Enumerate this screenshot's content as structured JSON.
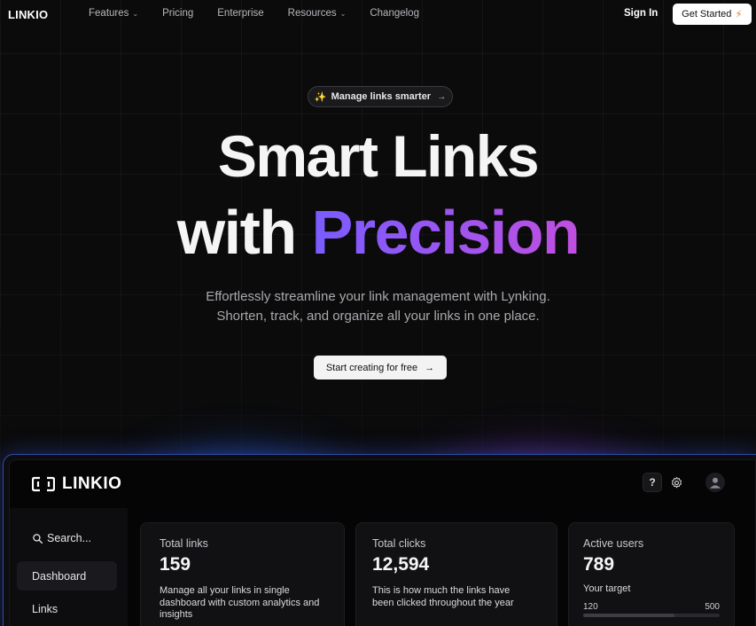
{
  "nav": {
    "logo": "LINKIO",
    "links": [
      {
        "label": "Features",
        "dropdown": true
      },
      {
        "label": "Pricing",
        "dropdown": false
      },
      {
        "label": "Enterprise",
        "dropdown": false
      },
      {
        "label": "Resources",
        "dropdown": true
      },
      {
        "label": "Changelog",
        "dropdown": false
      }
    ],
    "sign_in": "Sign In",
    "get_started": "Get Started"
  },
  "hero": {
    "badge": "Manage links smarter",
    "title_line1": "Smart Links",
    "title_line2_plain": "with ",
    "title_line2_accent": "Precision",
    "subtitle_line1": "Effortlessly streamline your link management with Lynking.",
    "subtitle_line2": "Shorten, track, and organize all your links in one place.",
    "cta": "Start creating for free"
  },
  "dashboard": {
    "logo": "LINKIO",
    "help_label": "?",
    "sidebar": {
      "search": "Search...",
      "items": [
        {
          "label": "Dashboard",
          "active": true
        },
        {
          "label": "Links",
          "active": false
        }
      ]
    },
    "cards": {
      "links": {
        "label": "Total links",
        "value": "159",
        "desc": "Manage all your links in single dashboard with custom analytics and insights"
      },
      "clicks": {
        "label": "Total clicks",
        "value": "12,594",
        "desc": "This is how much the links have been clicked throughout the year"
      },
      "users": {
        "label": "Active users",
        "value": "789",
        "target_label": "Your target",
        "range_min": "120",
        "range_max": "500",
        "progress_fraction": 0.67
      }
    }
  },
  "colors": {
    "accent_gradient_start": "#7b5cff",
    "accent_gradient_end": "#c04fe0",
    "bolt": "#f08a1c",
    "sparkle": "#f5c542",
    "background": "#0b0b0c"
  }
}
